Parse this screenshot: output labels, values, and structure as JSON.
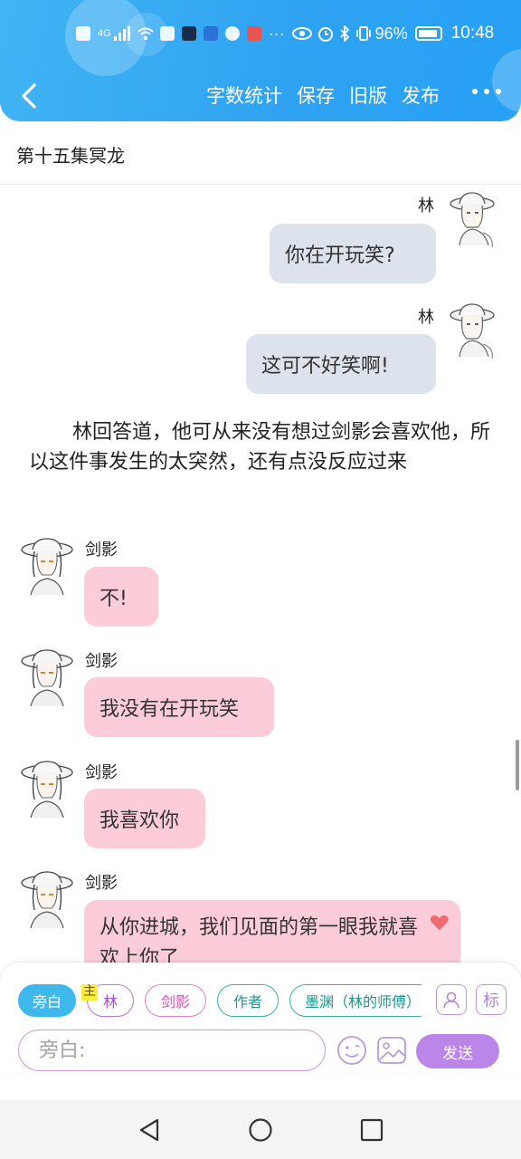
{
  "status_bar": {
    "network": "4G",
    "battery": "96%",
    "time": "10:48",
    "icons": [
      "hd-icon",
      "signal-icon",
      "wifi-icon",
      "toutiao-icon",
      "dashen-icon",
      "bulb-icon",
      "browser-icon",
      "book-icon",
      "overflow-icon",
      "eye-icon",
      "alarm-icon",
      "bluetooth-icon",
      "vibrate-icon",
      "battery-icon"
    ]
  },
  "header": {
    "actions": [
      "字数统计",
      "保存",
      "旧版",
      "发布"
    ],
    "brand_color": "#2fa3f1"
  },
  "chapter": {
    "title": "第十五集冥龙"
  },
  "messages": [
    {
      "speaker": "林",
      "side": "right",
      "text": "你在开玩笑?",
      "bubble_color": "#dde3ec"
    },
    {
      "speaker": "林",
      "side": "right",
      "text": "这可不好笑啊!",
      "bubble_color": "#dde3ec"
    },
    {
      "type": "narration",
      "text": "林回答道，他可从来没有想过剑影会喜欢他，所以这件事发生的太突然，还有点没反应过来"
    },
    {
      "speaker": "剑影",
      "side": "left",
      "text": "不!",
      "bubble_color": "#fcccd8"
    },
    {
      "speaker": "剑影",
      "side": "left",
      "text": "我没有在开玩笑",
      "bubble_color": "#fcccd8"
    },
    {
      "speaker": "剑影",
      "side": "left",
      "text": "我喜欢你",
      "bubble_color": "#fcccd8"
    },
    {
      "speaker": "剑影",
      "side": "left",
      "text": "从你进城，我们见面的第一眼我就喜欢上你了",
      "emoji": "heart-icon",
      "bubble_color": "#fcccd8"
    }
  ],
  "composer": {
    "roles": [
      {
        "label": "旁白",
        "selected": true
      },
      {
        "label": "林",
        "badge": "主"
      },
      {
        "label": "剑影"
      },
      {
        "label": "作者"
      },
      {
        "label": "墨渊（林的师傅）"
      }
    ],
    "add_role_icon": "add-character-icon",
    "tag_label": "标",
    "input_placeholder": "旁白:",
    "send_label": "发送",
    "send_color": "#bb86e8"
  },
  "system_nav": [
    "back-triangle-icon",
    "home-circle-icon",
    "recents-square-icon"
  ]
}
